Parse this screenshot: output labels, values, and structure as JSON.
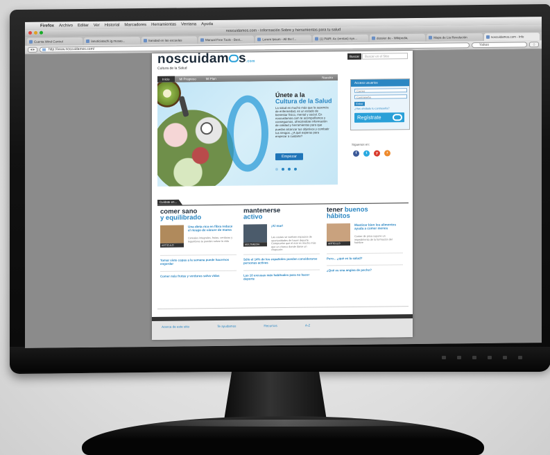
{
  "browser": {
    "menubar": [
      "Firefox",
      "Archivo",
      "Editar",
      "Ver",
      "Historial",
      "Marcadores",
      "Herramientas",
      "Ventana",
      "Ayuda"
    ],
    "window_title": "noscuidamos.com - Información Sobre y herramientas para tu salud",
    "tabs": [
      "Cuenta Wind Control",
      "lanoticiatachi.ig.musas...",
      "Sanidad en las escuelas",
      "Manual Free Tools - Best...",
      "Lorem Ipsum - All the f...",
      "(1) PAIR: Ac (ventas) nye...",
      "dossier de - Wikipedia,",
      "Mapa de Lia Revolución",
      "noscuidamos.com - Info"
    ],
    "url": "http://www.noscuidamos.com/",
    "search_placeholder": "Yahoo"
  },
  "site": {
    "logo_text": "noscuidam",
    "logo_tail": "s",
    "logo_com": ".com",
    "tagline": "Cultura de la Salud",
    "search_label": "Buscar",
    "search_placeholder": "Buscar en el Sitio",
    "nav": [
      "Inicio",
      "Mi Progreso",
      "Mi Plan"
    ],
    "nav_right": "Nuestro",
    "hero": {
      "title_line1": "Únete a la",
      "title_line2": "Cultura de la Salud",
      "text": "La salud es mucho más que la ausencia de enfermedad, es un estado de bienestar físico, mental y social. En noscuidamos.com te acompañamos y conseguimos, ofreciéndote información de calidad y herramientas para que puedas alcanzar tus objetivos y combatir tus riesgos. ¿A qué esperas para empezar a cuidarte?",
      "button": "Empezar"
    },
    "login": {
      "title": "Acceso usuarios",
      "email_placeholder": "Correo",
      "password_placeholder": "Contraseña",
      "enter_label": "Entrar",
      "forgot": "¿Has olvidado tu contraseña?",
      "register": "Regístrate"
    },
    "follow_label": "Síguenos en:",
    "social": [
      {
        "name": "f",
        "color": "#3b5998"
      },
      {
        "name": "t",
        "color": "#29aae1"
      },
      {
        "name": "y",
        "color": "#d93a2b"
      },
      {
        "name": "r",
        "color": "#ee8a2c"
      }
    ],
    "cuidate_tab": "Cuídate en...",
    "sections": [
      {
        "title_a": "comer sano",
        "title_b": "y equilibrado",
        "thumb_label": "ARTÍCULO",
        "thumb_color": "#b08a5c",
        "article_title": "Una dieta rica en fibra reduce el riesgo de cáncer de mama",
        "article_text": "Cereales integrales, frutas, verduras y legumbres te pueden salvar la vida",
        "links": [
          "Tomar siete copas a la semana puede hacernos engordar",
          "Comer más frutas y verduras salva vidas"
        ]
      },
      {
        "title_a": "mantenerse",
        "title_b": "activo",
        "thumb_label": "MULTIMEDIA",
        "thumb_color": "#4b5b6b",
        "article_title": "¡Al mar!",
        "article_text": "Las costas se vuelven espacios de oportunidades de hacer deporte. Compruebe que el mar es mucho más que un charco donde darse un chapuzón",
        "links": [
          "Sólo el 14% de los españoles pueden considerarse personas activas",
          "Las 10 excusas más habituales para no hacer deporte"
        ]
      },
      {
        "title_a": "tener",
        "title_b": "buenos",
        "title_c": "hábitos",
        "thumb_label": "ARTÍCULO",
        "thumb_color": "#c9a27e",
        "article_title": "Masticar bien los alimentos ayuda a comer menos",
        "article_text": "Comer de prisa supone un impedimento de la formación del hambre",
        "links": [
          "Pero... ¿qué es la salud?",
          "¿Qué es una angina de pecho?"
        ]
      }
    ],
    "footer_links": [
      "Acerca de este sitio",
      "Te ayudamos",
      "Recursos",
      "A-Z"
    ]
  }
}
